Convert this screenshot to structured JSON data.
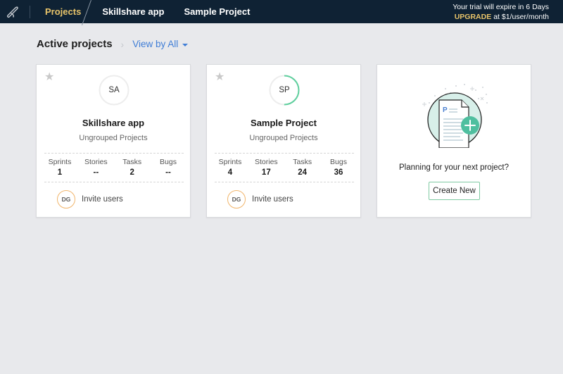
{
  "topbar": {
    "logo_icon": "quill-logo-icon",
    "nav": [
      {
        "label": "Projects",
        "active": true
      },
      {
        "label": "Skillshare app",
        "active": false
      },
      {
        "label": "Sample Project",
        "active": false
      }
    ],
    "trial_message": "Your trial will expire in 6 Days",
    "upgrade_label": "UPGRADE",
    "upgrade_price": "at $1/user/month"
  },
  "header": {
    "title": "Active projects",
    "separator_icon": "chevron-right-icon",
    "view_filter": "View by All"
  },
  "projects": [
    {
      "initials": "SA",
      "name": "Skillshare app",
      "group": "Ungrouped Projects",
      "progress_percent": 0,
      "stats": [
        {
          "label": "Sprints",
          "value": "1"
        },
        {
          "label": "Stories",
          "value": "--"
        },
        {
          "label": "Tasks",
          "value": "2"
        },
        {
          "label": "Bugs",
          "value": "--"
        }
      ],
      "user_initials": "DG",
      "invite_label": "Invite users"
    },
    {
      "initials": "SP",
      "name": "Sample Project",
      "group": "Ungrouped Projects",
      "progress_percent": 50,
      "stats": [
        {
          "label": "Sprints",
          "value": "4"
        },
        {
          "label": "Stories",
          "value": "17"
        },
        {
          "label": "Tasks",
          "value": "24"
        },
        {
          "label": "Bugs",
          "value": "36"
        }
      ],
      "user_initials": "DG",
      "invite_label": "Invite users"
    }
  ],
  "new_project": {
    "illustration_icon": "new-document-plus-icon",
    "prompt": "Planning for your next project?",
    "button_label": "Create New"
  },
  "colors": {
    "topbar_bg": "#0f2234",
    "active_nav": "#e8c46a",
    "link_blue": "#3f7dd6",
    "progress_green": "#5fcf9e",
    "user_ring": "#f1b56b"
  }
}
